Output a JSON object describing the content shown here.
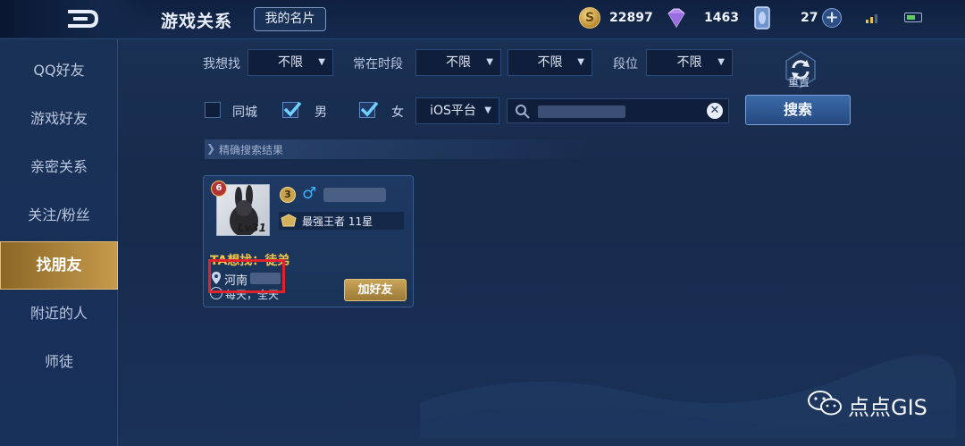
{
  "header": {
    "title": "游戏关系",
    "card_button": "我的名片",
    "currencies": {
      "gold": "22897",
      "diamond": "1463",
      "coupon": "27"
    }
  },
  "sidebar": {
    "items": [
      {
        "label": "QQ好友",
        "active": false
      },
      {
        "label": "游戏好友",
        "active": false
      },
      {
        "label": "亲密关系",
        "active": false
      },
      {
        "label": "关注/粉丝",
        "active": false
      },
      {
        "label": "找朋友",
        "active": true
      },
      {
        "label": "附近的人",
        "active": false
      },
      {
        "label": "师徒",
        "active": false
      }
    ]
  },
  "filters": {
    "want_label": "我想找",
    "want_value": "不限",
    "time_label": "常在时段",
    "time_value_1": "不限",
    "time_value_2": "不限",
    "rank_label": "段位",
    "rank_value": "不限",
    "reset_label": "重置",
    "same_city_label": "同城",
    "same_city_checked": false,
    "male_label": "男",
    "male_checked": true,
    "female_label": "女",
    "female_checked": true,
    "platform_value": "iOS平台",
    "search_button": "搜索"
  },
  "results": {
    "section_title": "精确搜索结果",
    "card": {
      "vip_level": "6",
      "avatar_level": "Lv31",
      "honor_level": "3",
      "rank": "最强王者 11星",
      "want": "TA想找：徒弟",
      "location": "河南",
      "time": "每天，全天",
      "add_button": "加好友"
    }
  },
  "watermark": {
    "text": "点点GIS"
  },
  "colors": {
    "accent_gold": "#c79b4d",
    "highlight_red": "#e0232b",
    "background": "#1a3158"
  }
}
